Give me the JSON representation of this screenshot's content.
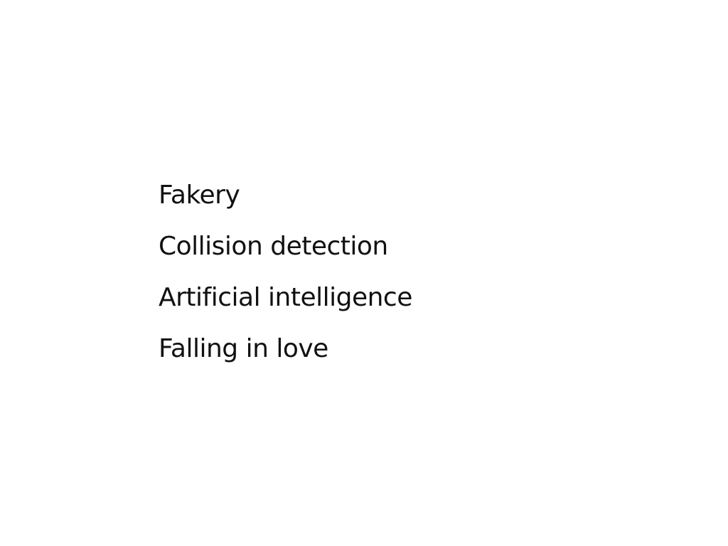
{
  "slide": {
    "items": [
      "Fakery",
      "Collision detection",
      "Artificial intelligence",
      "Falling in love"
    ]
  },
  "colors": {
    "background": "#ffffff",
    "text": "#111111"
  }
}
